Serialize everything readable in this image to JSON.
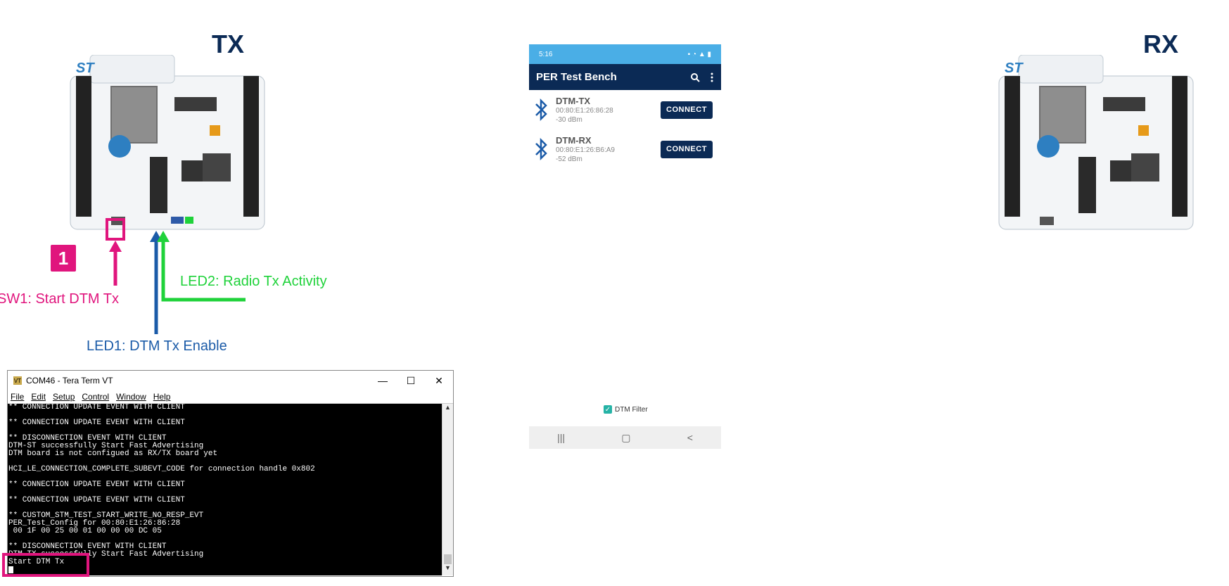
{
  "boards": {
    "tx_title": "TX",
    "rx_title": "RX"
  },
  "annotations": {
    "step_badge": "1",
    "sw1": "SW1: Start DTM Tx",
    "led2": "LED2: Radio Tx Activity",
    "led1": "LED1: DTM Tx Enable"
  },
  "phone": {
    "status_time": "5:16",
    "app_title": "PER Test Bench",
    "devices": [
      {
        "name": "DTM-TX",
        "address": "00:80:E1:26:86:28",
        "rssi": "-30 dBm",
        "button": "CONNECT"
      },
      {
        "name": "DTM-RX",
        "address": "00:80:E1:26:B6:A9",
        "rssi": "-52 dBm",
        "button": "CONNECT"
      }
    ],
    "filter_label": "DTM Filter",
    "filter_checked": true,
    "nav": [
      "|||",
      "▢",
      "<"
    ]
  },
  "terminal": {
    "title": "COM46 - Tera Term VT",
    "menu": [
      "File",
      "Edit",
      "Setup",
      "Control",
      "Window",
      "Help"
    ],
    "lines": [
      "** CONNECTION UPDATE EVENT WITH CLIENT",
      "",
      "** CONNECTION UPDATE EVENT WITH CLIENT",
      "",
      "** DISCONNECTION EVENT WITH CLIENT",
      "DTM-ST successfully Start Fast Advertising",
      "DTM board is not configued as RX/TX board yet",
      "",
      "HCI_LE_CONNECTION_COMPLETE_SUBEVT_CODE for connection handle 0x802",
      "",
      "** CONNECTION UPDATE EVENT WITH CLIENT",
      "",
      "** CONNECTION UPDATE EVENT WITH CLIENT",
      "",
      "** CUSTOM_STM_TEST_START_WRITE_NO_RESP_EVT",
      "PER_Test_Config for 00:80:E1:26:86:28",
      " 00 1F 00 25 00 01 00 00 00 DC 05",
      "",
      "** DISCONNECTION EVENT WITH CLIENT",
      "DTM-TX successfully Start Fast Advertising",
      "Start DTM Tx"
    ]
  },
  "colors": {
    "navy": "#0b2a55",
    "magenta": "#e0157d",
    "green": "#1fd23a",
    "blue": "#1b5ba8",
    "status_bar": "#4aaee6"
  }
}
